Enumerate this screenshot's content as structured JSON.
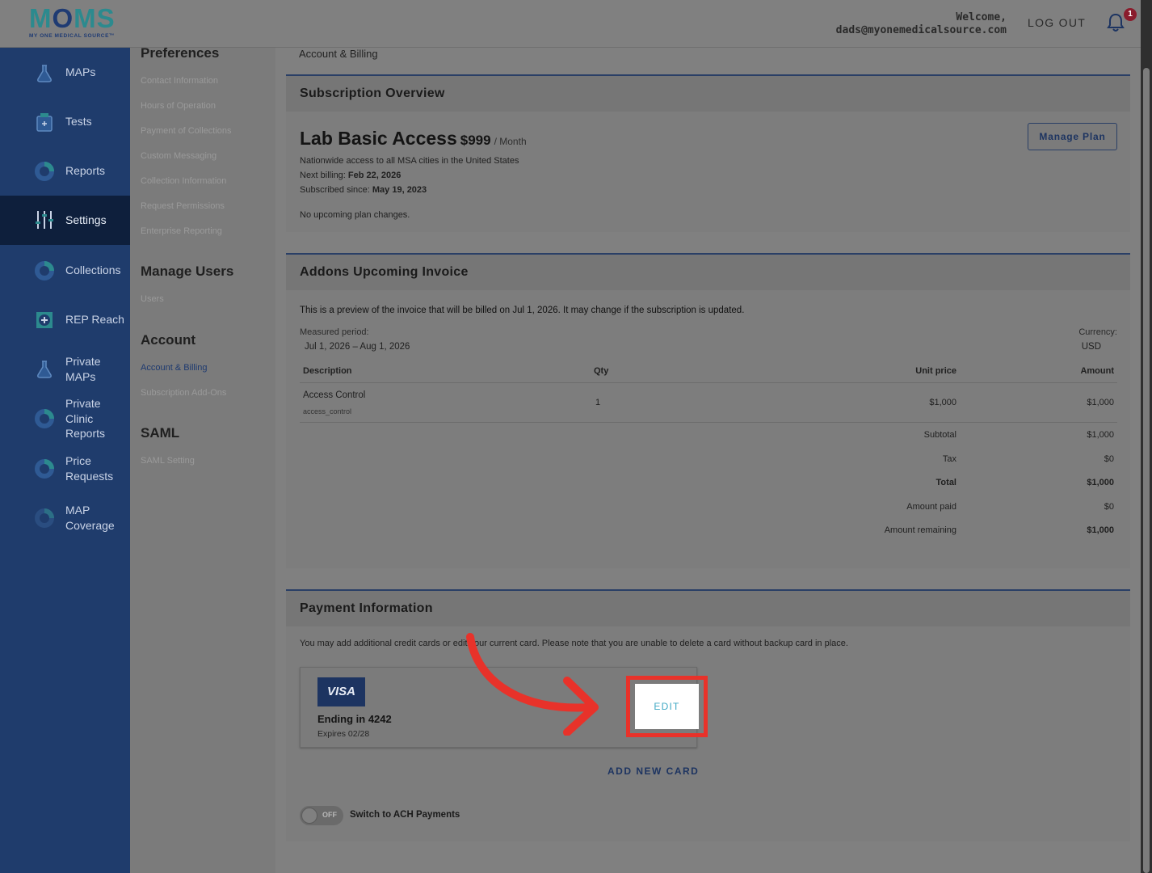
{
  "header": {
    "logo_main": "M",
    "logo_heart": "O",
    "logo_end": "MS",
    "logo_sub": "MY ONE MEDICAL SOURCE™",
    "welcome_label": "Welcome,",
    "user_email": "dads@myonemedicalsource.com",
    "logout_label": "LOG OUT",
    "notification_count": "1"
  },
  "sidebar": {
    "items": [
      {
        "label": "MAPs",
        "icon": "flask-icon"
      },
      {
        "label": "Tests",
        "icon": "test-kit-icon"
      },
      {
        "label": "Reports",
        "icon": "donut-chart-icon"
      },
      {
        "label": "Settings",
        "icon": "sliders-icon"
      },
      {
        "label": "Collections",
        "icon": "donut-chart-icon"
      },
      {
        "label": "REP Reach",
        "icon": "plus-box-icon"
      },
      {
        "label": "Private MAPs",
        "icon": "flask-icon"
      },
      {
        "label": "Private Clinic Reports",
        "icon": "donut-chart-icon"
      },
      {
        "label": "Price Requests",
        "icon": "donut-chart-icon"
      },
      {
        "label": "MAP Coverage",
        "icon": "donut-chart-icon"
      }
    ]
  },
  "subnav": {
    "preferences_head": "Preferences",
    "preferences": [
      "Contact Information",
      "Hours of Operation",
      "Payment of Collections",
      "Custom Messaging",
      "Collection Information",
      "Request Permissions",
      "Enterprise Reporting"
    ],
    "users_head": "Manage Users",
    "users": [
      "Users"
    ],
    "account_head": "Account",
    "account": [
      "Account & Billing",
      "Subscription Add-Ons"
    ],
    "saml_head": "SAML",
    "saml": [
      "SAML Setting"
    ]
  },
  "main": {
    "breadcrumb": "Account & Billing",
    "subscription": {
      "heading": "Subscription Overview",
      "plan_name": "Lab Basic Access",
      "price": "$999",
      "period": "/ Month",
      "description": "Nationwide access to all MSA cities in the United States",
      "next_billing_label": "Next billing:",
      "next_billing": "Feb 22, 2026",
      "since_label": "Subscribed since:",
      "since": "May 19, 2023",
      "changes": "No upcoming plan changes.",
      "manage_label": "Manage Plan"
    },
    "invoice": {
      "heading": "Addons Upcoming Invoice",
      "preview_note": "This is a preview of the invoice that will be billed on Jul 1, 2026. It may change if the subscription is updated.",
      "period_label": "Measured period:",
      "period": "Jul 1, 2026 – Aug 1, 2026",
      "currency_label": "Currency:",
      "currency": "USD",
      "columns": {
        "description": "Description",
        "qty": "Qty",
        "unit_price": "Unit price",
        "amount": "Amount"
      },
      "rows": [
        {
          "description": "Access Control",
          "code": "access_control",
          "qty": "1",
          "unit_price": "$1,000",
          "amount": "$1,000"
        }
      ],
      "totals": [
        {
          "label": "Subtotal",
          "value": "$1,000",
          "bold": false
        },
        {
          "label": "Tax",
          "value": "$0",
          "bold": false
        },
        {
          "label": "Total",
          "value": "$1,000",
          "bold": true
        },
        {
          "label": "Amount paid",
          "value": "$0",
          "bold": false
        },
        {
          "label": "Amount remaining",
          "value": "$1,000",
          "bold": true
        }
      ]
    },
    "payment": {
      "heading": "Payment Information",
      "note": "You may add additional credit cards or edit your current card. Please note that you are unable to delete a card without backup card in place.",
      "card_brand": "VISA",
      "ending": "Ending in 4242",
      "expires": "Expires 02/28",
      "edit_label": "EDIT",
      "add_card_label": "ADD NEW CARD",
      "toggle_state": "OFF",
      "toggle_label": "Switch to ACH Payments"
    }
  },
  "colors": {
    "sidebar": "#1f3c6c",
    "sidebar_active": "#0e1f3c",
    "accent": "#2c8a8e",
    "highlight": "#e8322a",
    "edit_text": "#41a9c4"
  }
}
